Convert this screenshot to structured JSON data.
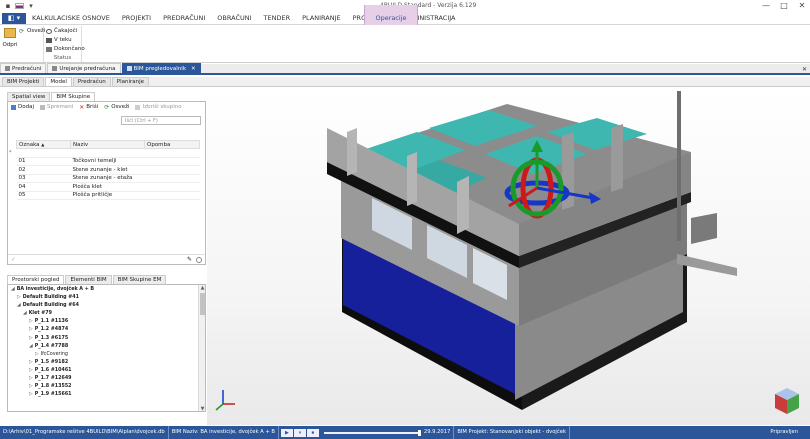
{
  "window": {
    "title": "4BUILD Standard - Verzija 6.129",
    "controls": [
      "—",
      "□",
      "✕"
    ]
  },
  "ribbon": {
    "app_button": "◧ ▾",
    "tabs": [
      "KALKULACISKE OSNOVE",
      "PROJEKTI",
      "PREDRAČUNI",
      "OBRAČUNI",
      "TENDER",
      "PLANIRANJE",
      "PROJEKTIVA",
      "ADMINISTRACIJA"
    ],
    "context_tab": "Operacije",
    "open_button": "Odpri",
    "refresh_button": "Osveži",
    "status_items": [
      "Čakajoči",
      "V teku",
      "Dokončano"
    ],
    "status_group_label": "Status"
  },
  "doc_tabs": [
    {
      "label": "Predračuni"
    },
    {
      "label": "Urejanje predračuna"
    },
    {
      "label": "BIM pregledovalnik"
    }
  ],
  "sub_tabs": [
    "BIM Projekti",
    "Model",
    "Predračun",
    "Planiranje"
  ],
  "top_panel": {
    "tabs": [
      "Spatial view",
      "BIM Skupine"
    ],
    "toolbar": {
      "add": "Dodaj",
      "save": "Spremeni",
      "delete": "Briši",
      "refresh": "Osveži",
      "remove": "Izbriši skupino"
    },
    "search_placeholder": "Išči (Ctrl + F)",
    "columns": [
      "Oznaka",
      "Naziv",
      "Opomba"
    ],
    "rows": [
      {
        "code": "01",
        "name": "Točkovni temelji",
        "note": ""
      },
      {
        "code": "02",
        "name": "Stene zunanje - klet",
        "note": ""
      },
      {
        "code": "03",
        "name": "Stene zunanje - etaža",
        "note": ""
      },
      {
        "code": "04",
        "name": "Plošča klet",
        "note": ""
      },
      {
        "code": "05",
        "name": "Plošča pritličje",
        "note": ""
      }
    ]
  },
  "bottom_panel": {
    "tabs": [
      "Prostorski pogled",
      "Elementi BIM",
      "BIM Skupine EM"
    ],
    "tree": [
      {
        "label": "BA investicije, dvojček A + B",
        "level": 0,
        "bold": true,
        "arrow": "◢"
      },
      {
        "label": "Default Building #41",
        "level": 1,
        "bold": true,
        "arrow": "▷"
      },
      {
        "label": "Default Building #64",
        "level": 1,
        "bold": true,
        "arrow": "◢"
      },
      {
        "label": "Klet #79",
        "level": 2,
        "bold": true,
        "arrow": "◢"
      },
      {
        "label": "P_1.1 #1136",
        "level": 3,
        "bold": true,
        "arrow": "▷"
      },
      {
        "label": "P_1.2 #4874",
        "level": 3,
        "bold": true,
        "arrow": "▷"
      },
      {
        "label": "P_1.3 #6175",
        "level": 3,
        "bold": true,
        "arrow": "▷"
      },
      {
        "label": "P_1.4 #7788",
        "level": 3,
        "bold": true,
        "arrow": "◢"
      },
      {
        "label": "IfcCovering",
        "level": 4,
        "bold": false,
        "arrow": "▷"
      },
      {
        "label": "P_1.5 #9182",
        "level": 3,
        "bold": true,
        "arrow": "▷"
      },
      {
        "label": "P_1.6 #10461",
        "level": 3,
        "bold": true,
        "arrow": "▷"
      },
      {
        "label": "P_1.7 #12649",
        "level": 3,
        "bold": true,
        "arrow": "▷"
      },
      {
        "label": "P_1.8 #13552",
        "level": 3,
        "bold": true,
        "arrow": "▷"
      },
      {
        "label": "P_1.9 #15661",
        "level": 3,
        "bold": true,
        "arrow": "▷"
      }
    ]
  },
  "statusbar": {
    "path": "D:\\Arhiv\\01_Programske rešitve 4BUILD\\BIM\\Alplan\\dvojcek.db",
    "bim_name": "BIM Naziv: BA investicije, dvojček A + B",
    "controls": [
      "▶",
      "⏸",
      "⏹"
    ],
    "date": "29.9.2017",
    "bim_project": "BIM Projekt: Stanovanjski objekt - dvojček",
    "user": "Pripravljen"
  },
  "colors": {
    "accent": "#2b579a",
    "context_tab": "#e8cfe8",
    "wall": "#8c8c8c",
    "floor_teal": "#3eb7b0",
    "facade_blue": "#16209a"
  },
  "icons": [
    "open-folder-icon",
    "refresh-icon",
    "clock-icon",
    "progress-icon",
    "done-icon",
    "add-icon",
    "save-icon",
    "delete-icon",
    "remove-group-icon",
    "pencil-icon",
    "view-cube-icon",
    "axis-icon",
    "gizmo-icon"
  ]
}
